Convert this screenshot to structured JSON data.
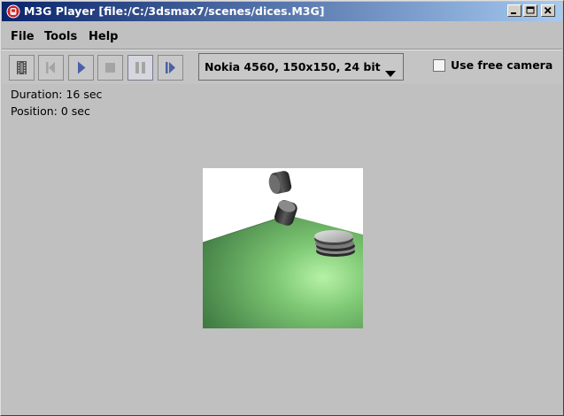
{
  "window": {
    "title": "M3G Player  [file:/C:/3dsmax7/scenes/dices.M3G]"
  },
  "menu": {
    "items": [
      "File",
      "Tools",
      "Help"
    ]
  },
  "toolbar": {
    "buttons": [
      {
        "icon": "film-strip-icon"
      },
      {
        "icon": "step-back-icon"
      },
      {
        "icon": "play-icon"
      },
      {
        "icon": "stop-icon"
      },
      {
        "icon": "pause-icon"
      },
      {
        "icon": "step-forward-icon"
      }
    ],
    "device_select": {
      "value": "Nokia 4560, 150x150, 24 bit"
    },
    "free_camera": {
      "label": "Use free camera",
      "checked": false
    }
  },
  "status": {
    "duration": "Duration: 16 sec",
    "position": "Position: 0 sec"
  },
  "colors": {
    "titlebar_start": "#0a246a",
    "titlebar_end": "#a6caf0",
    "background": "#c0c0c0",
    "floor_green": "#5fa85f"
  }
}
